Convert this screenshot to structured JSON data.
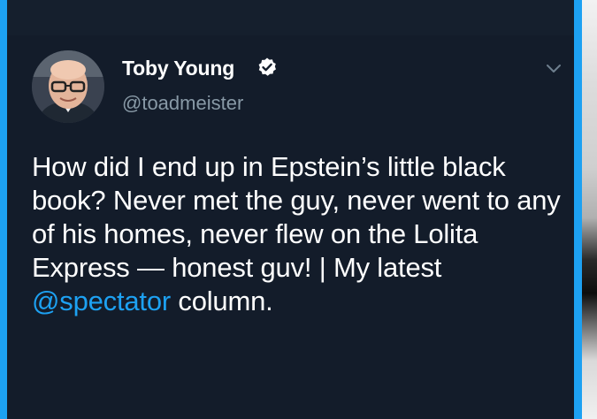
{
  "tweet": {
    "author": {
      "display_name": "Toby Young",
      "handle": "@toadmeister",
      "verified": true,
      "avatar_icon": "user-avatar-photo"
    },
    "menu_icon": "chevron-down-icon",
    "text": {
      "part1": "How did I end up in Epstein’s little black book? Never met the guy, never went to any of his homes, never flew on the Lolita Express — honest guv! | My latest ",
      "mention": "@spectator",
      "part2": " column."
    }
  },
  "colors": {
    "background": "#131c2a",
    "frame_accent": "#1DA1F2",
    "text_primary": "#ffffff",
    "text_secondary": "#8899a6",
    "mention": "#1DA1F2"
  }
}
